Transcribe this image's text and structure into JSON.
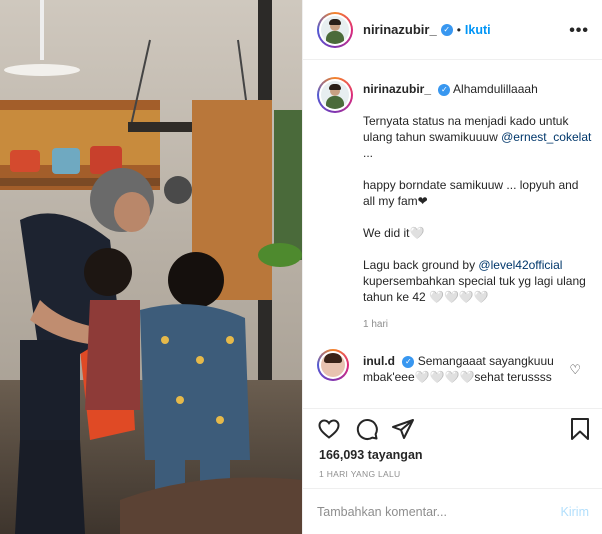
{
  "post": {
    "username": "nirinazubir_",
    "follow_label": "Ikuti",
    "more_glyph": "•••",
    "caption_username": "nirinazubir_",
    "caption_first": "Alhamdulillaaah",
    "caption_line1": "Ternyata status na menjadi kado untuk ulang tahun swamikuuuw",
    "caption_mention1": "@ernest_cokelat",
    "caption_after_mention1": " ...",
    "caption_para2": "happy borndate samikuuw ... lopyuh and all my fam❤",
    "caption_para3": "We did it🤍",
    "caption_para4_pre": "Lagu back ground by ",
    "caption_mention2": "@level42official",
    "caption_para4_post": " kupersembahkan special tuk yg lagi ulang tahun ke 42 🤍🤍🤍🤍",
    "caption_time": "1 hari"
  },
  "comments": [
    {
      "username": "inul.d",
      "text": "Semangaaat sayangkuuu mbak'eee🤍🤍🤍🤍sehat terussss"
    }
  ],
  "stats": {
    "views": "166,093 tayangan",
    "date": "1 HARI YANG LALU"
  },
  "comment_box": {
    "placeholder": "Tambahkan komentar...",
    "post_label": "Kirim"
  },
  "icons": {
    "like": "heart-icon",
    "comment": "comment-icon",
    "share": "share-icon",
    "save": "bookmark-icon",
    "verified": "verified-badge-icon"
  },
  "colors": {
    "accent": "#0095f6",
    "mention": "#00376b",
    "muted": "#8e8e8e",
    "verified": "#3897f0"
  }
}
